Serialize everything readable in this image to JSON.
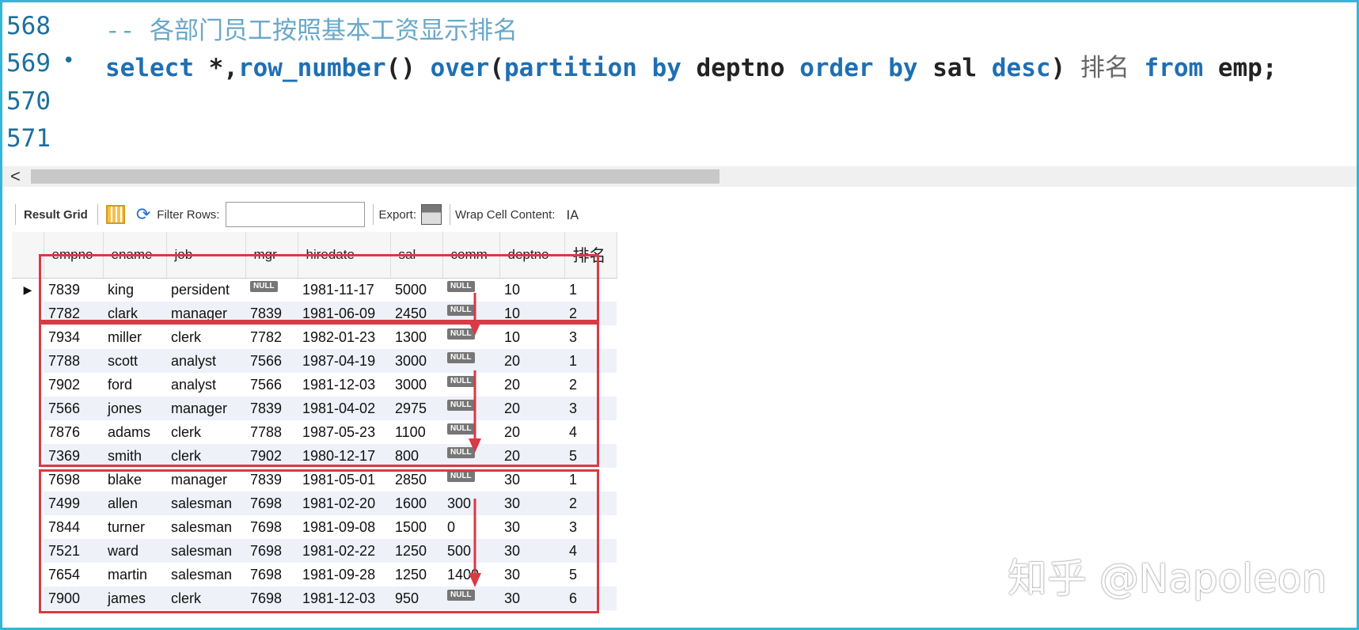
{
  "editor": {
    "lines": [
      {
        "number": "568",
        "comment": "-- 各部门员工按照基本工资显示排名"
      },
      {
        "number": "569",
        "marker": "•",
        "tokens": {
          "k1": "select",
          "t1": " *,",
          "k2": "row_number",
          "t2": "() ",
          "k3": "over",
          "t3": "(",
          "k4": "partition by",
          "t4": " deptno ",
          "k5": "order by",
          "t5": " sal ",
          "k6": "desc",
          "t6": ") ",
          "zh": "排名",
          "k7": " from",
          "t7": " emp;"
        }
      },
      {
        "number": "570"
      },
      {
        "number": "571"
      }
    ],
    "scroll_arrow": "<"
  },
  "toolbar": {
    "result_grid": "Result Grid",
    "filter_rows": "Filter Rows:",
    "filter_value": "",
    "export": "Export:",
    "wrap": "Wrap Cell Content:",
    "wrap_icon": "IA"
  },
  "grid": {
    "columns": [
      "empno",
      "ename",
      "job",
      "mgr",
      "hiredate",
      "sal",
      "comm",
      "deptno",
      "排名"
    ],
    "null_label": "NULL",
    "rows": [
      [
        "7839",
        "king",
        "persident",
        null,
        "1981-11-17",
        "5000",
        null,
        "10",
        "1"
      ],
      [
        "7782",
        "clark",
        "manager",
        "7839",
        "1981-06-09",
        "2450",
        null,
        "10",
        "2"
      ],
      [
        "7934",
        "miller",
        "clerk",
        "7782",
        "1982-01-23",
        "1300",
        null,
        "10",
        "3"
      ],
      [
        "7788",
        "scott",
        "analyst",
        "7566",
        "1987-04-19",
        "3000",
        null,
        "20",
        "1"
      ],
      [
        "7902",
        "ford",
        "analyst",
        "7566",
        "1981-12-03",
        "3000",
        null,
        "20",
        "2"
      ],
      [
        "7566",
        "jones",
        "manager",
        "7839",
        "1981-04-02",
        "2975",
        null,
        "20",
        "3"
      ],
      [
        "7876",
        "adams",
        "clerk",
        "7788",
        "1987-05-23",
        "1100",
        null,
        "20",
        "4"
      ],
      [
        "7369",
        "smith",
        "clerk",
        "7902",
        "1980-12-17",
        "800",
        null,
        "20",
        "5"
      ],
      [
        "7698",
        "blake",
        "manager",
        "7839",
        "1981-05-01",
        "2850",
        null,
        "30",
        "1"
      ],
      [
        "7499",
        "allen",
        "salesman",
        "7698",
        "1981-02-20",
        "1600",
        "300",
        "30",
        "2"
      ],
      [
        "7844",
        "turner",
        "salesman",
        "7698",
        "1981-09-08",
        "1500",
        "0",
        "30",
        "3"
      ],
      [
        "7521",
        "ward",
        "salesman",
        "7698",
        "1981-02-22",
        "1250",
        "500",
        "30",
        "4"
      ],
      [
        "7654",
        "martin",
        "salesman",
        "7698",
        "1981-09-28",
        "1250",
        "1400",
        "30",
        "5"
      ],
      [
        "7900",
        "james",
        "clerk",
        "7698",
        "1981-12-03",
        "950",
        null,
        "30",
        "6"
      ]
    ]
  },
  "colors": {
    "highlight_box": "#d93a45",
    "frame_border": "#35b6d4",
    "keyword": "#1f6fb2"
  },
  "watermark": "知乎 @Napoleon"
}
